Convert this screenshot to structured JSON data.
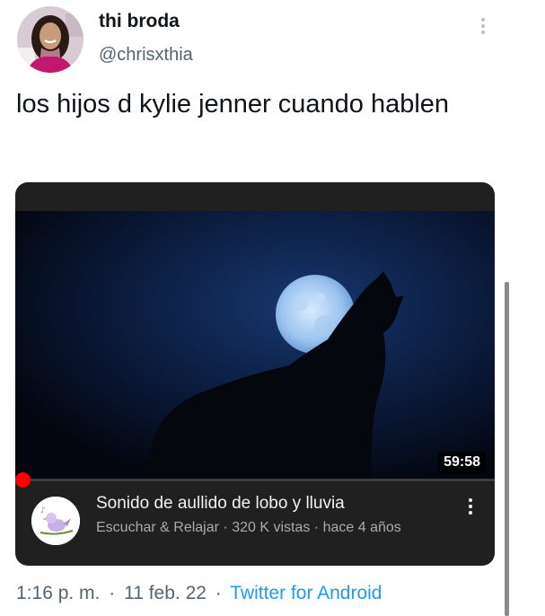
{
  "tweet": {
    "display_name": "thi broda",
    "handle": "@chrisxthia",
    "text": "los hijos d kylie jenner cuando hablen",
    "time": "1:16 p. m.",
    "date": "11 feb. 22",
    "source": "Twitter for Android",
    "separator": "·"
  },
  "video": {
    "title": "Sonido de aullido de lobo y lluvia",
    "channel": "Escuchar & Relajar",
    "views": "320 K vistas",
    "age": "hace 4 años",
    "duration": "59:58",
    "meta_separator": "·",
    "progress_fraction": 0.0
  },
  "icons": {
    "tweet_more": "vertical-dots-icon",
    "video_more": "vertical-dots-icon"
  },
  "colors": {
    "link": "#1d9bf0",
    "muted": "#536471",
    "card_bg": "#202020",
    "progress_red": "#ff0000"
  }
}
